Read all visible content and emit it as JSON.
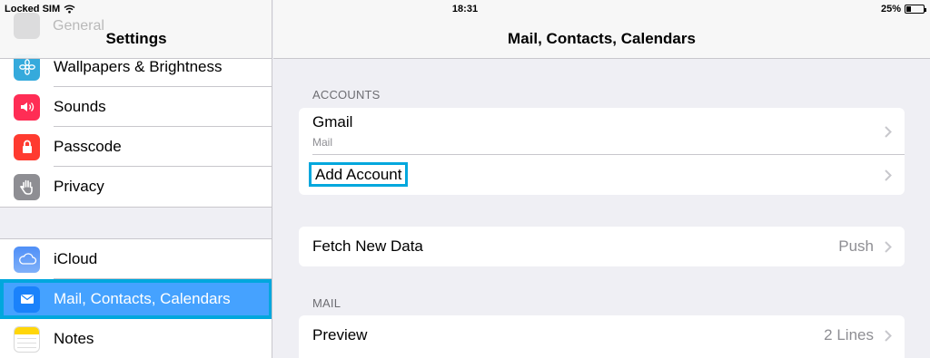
{
  "status_bar": {
    "carrier": "Locked SIM",
    "time": "18:31",
    "battery": "25%",
    "battery_level": 0.25
  },
  "sidebar": {
    "title": "Settings",
    "ghost_item": "General",
    "group1": [
      {
        "label": "Wallpapers & Brightness",
        "icon": "flower-icon",
        "color": "#35aadc"
      },
      {
        "label": "Sounds",
        "icon": "speaker-icon",
        "color": "#ff2d55"
      },
      {
        "label": "Passcode",
        "icon": "lock-icon",
        "color": "#ff3b30"
      },
      {
        "label": "Privacy",
        "icon": "hand-icon",
        "color": "#8e8e93"
      }
    ],
    "group2": [
      {
        "label": "iCloud",
        "icon": "cloud-icon",
        "color": "#5b8ff9"
      },
      {
        "label": "Mail, Contacts, Calendars",
        "icon": "envelope-icon",
        "color": "#1a82fb",
        "selected": true
      },
      {
        "label": "Notes",
        "icon": "notes-icon",
        "color": "#ffd60a"
      }
    ]
  },
  "main": {
    "title": "Mail, Contacts, Calendars",
    "accounts_header": "ACCOUNTS",
    "accounts": [
      {
        "title": "Gmail",
        "subtitle": "Mail"
      },
      {
        "title": "Add Account"
      }
    ],
    "fetch": {
      "label": "Fetch New Data",
      "value": "Push"
    },
    "mail_header": "MAIL",
    "preview": {
      "label": "Preview",
      "value": "2 Lines"
    }
  },
  "colors": {
    "accent": "#00a7dd",
    "selected_bg": "#45a2ff",
    "background": "#efeff4"
  }
}
